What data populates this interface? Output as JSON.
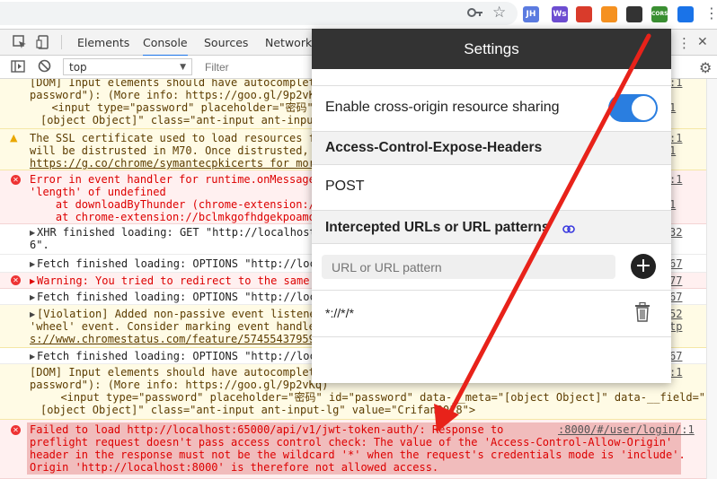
{
  "browser": {
    "key_icon": "key-icon",
    "star_icon": "star-icon",
    "extensions": [
      {
        "name": "jh-extension-icon",
        "label": "JH",
        "color": "#5b7be0"
      },
      {
        "name": "ws-extension-icon",
        "label": "Ws",
        "color": "#6d4dd1"
      },
      {
        "name": "red-extension-icon",
        "label": "",
        "color": "#d93b2b"
      },
      {
        "name": "orange-extension-icon",
        "label": "",
        "color": "#f59120"
      },
      {
        "name": "qr-extension-icon",
        "label": "",
        "color": "#333333"
      },
      {
        "name": "cors-extension-icon",
        "label": "CORS",
        "color": "#3a8f32"
      },
      {
        "name": "blue-extension-icon",
        "label": "",
        "color": "#1a73e8"
      }
    ],
    "menu_icon": "⋮"
  },
  "devtools": {
    "tabs": [
      "Elements",
      "Console",
      "Sources",
      "Network"
    ],
    "active_tab": "Console",
    "context": "top",
    "filter_placeholder": "Filter",
    "more_icon": "⋮",
    "close_icon": "✕"
  },
  "console": {
    "messages": [
      {
        "lines": [
          "[DOM] Input elements should have autocomplet",
          "password\"): (More info: https://goo.gl/9p2vK",
          "  <input type=\"password\" placeholder=\"密码\" i",
          "[object Object]\" class=\"ant-input ant-inpu"
        ],
        "src": ":1"
      },
      {
        "lines": [
          "The SSL certificate used to load resources f",
          "will be distrusted in M70. Once distrusted,",
          "https://g.co/chrome/symantecpkicerts for mor"
        ],
        "src": ":1"
      },
      {
        "lines": [
          "Error in event handler for runtime.onMessage",
          "'length' of undefined",
          "    at downloadByThunder (chrome-extension:/",
          "    at chrome-extension://bclmkgofhdgekpoamo"
        ],
        "src": ":1"
      },
      {
        "lines": [
          "XHR finished loading: GET \"http://localhost",
          "6\"."
        ],
        "src": "32"
      },
      {
        "lines": [
          "Fetch finished loading: OPTIONS \"http://loc"
        ],
        "src": "67"
      },
      {
        "lines": [
          "Warning: You tried to redirect to the same"
        ],
        "src": "77"
      },
      {
        "lines": [
          "Fetch finished loading: OPTIONS \"http://loc"
        ],
        "src": "67"
      },
      {
        "lines": [
          "[Violation] Added non-passive event listene",
          "'wheel' event. Consider marking event handle",
          "s://www.chromestatus.com/feature/57455437959"
        ],
        "src": "52"
      },
      {
        "lines": [
          "Fetch finished loading: OPTIONS \"http://loc"
        ],
        "src": "67"
      },
      {
        "lines": [
          "[DOM] Input elements should have autocomplet",
          "password\"): (More info: https://goo.gl/9p2vKq)",
          "  <input type=\"password\" placeholder=\"密码\" id=\"password\" data-__meta=\"[object Object]\" data-__field=\"",
          "[object Object]\" class=\"ant-input ant-input-lg\" value=\"Crifan2018\">"
        ],
        "src": ":1"
      },
      {
        "lines": [
          "Failed to load http://localhost:65000/api/v1/jwt-token-auth/: Response to",
          "preflight request doesn't pass access control check: The value of the 'Access-Control-Allow-Origin'",
          "header in the response must not be the wildcard '*' when the request's credentials mode is 'include'.",
          "Origin 'http://localhost:8000' is therefore not allowed access."
        ],
        "src": ":8000/#/user/login/:1"
      }
    ],
    "extra_srcs": [
      "1",
      "1",
      "1",
      "1",
      "67",
      "tp",
      "1",
      "1"
    ]
  },
  "settings": {
    "title": "Settings",
    "cors_label": "Enable cross-origin resource sharing",
    "cors_enabled": true,
    "expose_headers_title": "Access-Control-Expose-Headers",
    "expose_headers_value": "POST",
    "intercepted_title": "Intercepted URLs or URL patterns",
    "link_icon": "link-icon",
    "url_placeholder": "URL or URL pattern",
    "add_icon": "+",
    "patterns": [
      "*://*/*"
    ],
    "delete_icon": "trash-icon"
  },
  "annotation": {
    "arrow_color": "#e8221a"
  }
}
